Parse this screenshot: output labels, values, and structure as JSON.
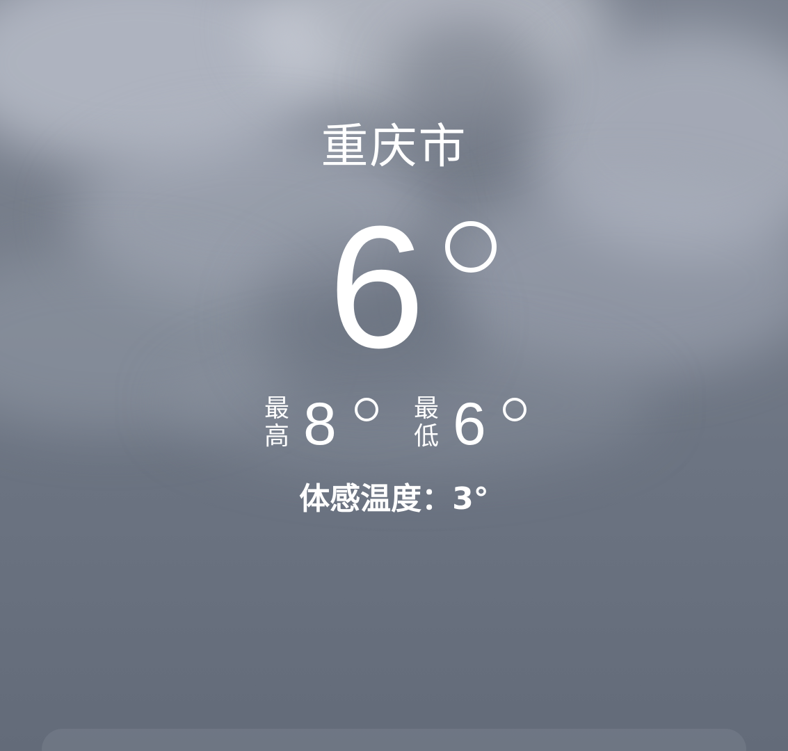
{
  "location": {
    "city": "重庆市"
  },
  "current": {
    "temperature": "6"
  },
  "range": {
    "high_label_top": "最",
    "high_label_bottom": "高",
    "high_value": "8",
    "low_label_top": "最",
    "low_label_bottom": "低",
    "low_value": "6"
  },
  "feels_like": {
    "text": "体感温度：3°"
  },
  "colors": {
    "sky_top": "#7a818e",
    "sky_bottom": "#636b79",
    "text": "#ffffff"
  }
}
